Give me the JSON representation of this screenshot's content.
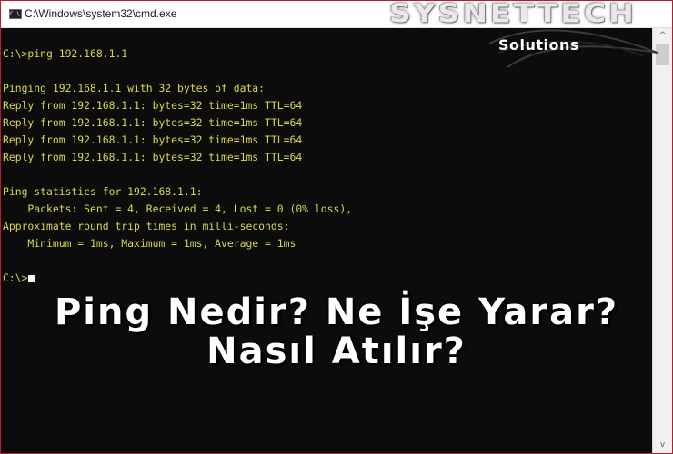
{
  "window": {
    "title": "C:\\Windows\\system32\\cmd.exe",
    "icon": "cmd-icon",
    "icon_text": "C:\\."
  },
  "console": {
    "lines": [
      "C:\\>ping 192.168.1.1",
      "",
      "Pinging 192.168.1.1 with 32 bytes of data:",
      "Reply from 192.168.1.1: bytes=32 time=1ms TTL=64",
      "Reply from 192.168.1.1: bytes=32 time=1ms TTL=64",
      "Reply from 192.168.1.1: bytes=32 time=1ms TTL=64",
      "Reply from 192.168.1.1: bytes=32 time=1ms TTL=64",
      "",
      "Ping statistics for 192.168.1.1:",
      "    Packets: Sent = 4, Received = 4, Lost = 0 (0% loss),",
      "Approximate round trip times in milli-seconds:",
      "    Minimum = 1ms, Maximum = 1ms, Average = 1ms",
      ""
    ],
    "prompt": "C:\\>",
    "text_color": "#d8d84a",
    "background_color": "#0c0c0c"
  },
  "scrollbar": {
    "up_arrow": "^",
    "down_arrow": "v"
  },
  "overlay": {
    "headline_line1": "Ping Nedir? Ne İşe Yarar?",
    "headline_line2": "Nasıl Atılır?"
  },
  "logo": {
    "brand": "SYSNETTECH",
    "tagline": "Solutions"
  }
}
